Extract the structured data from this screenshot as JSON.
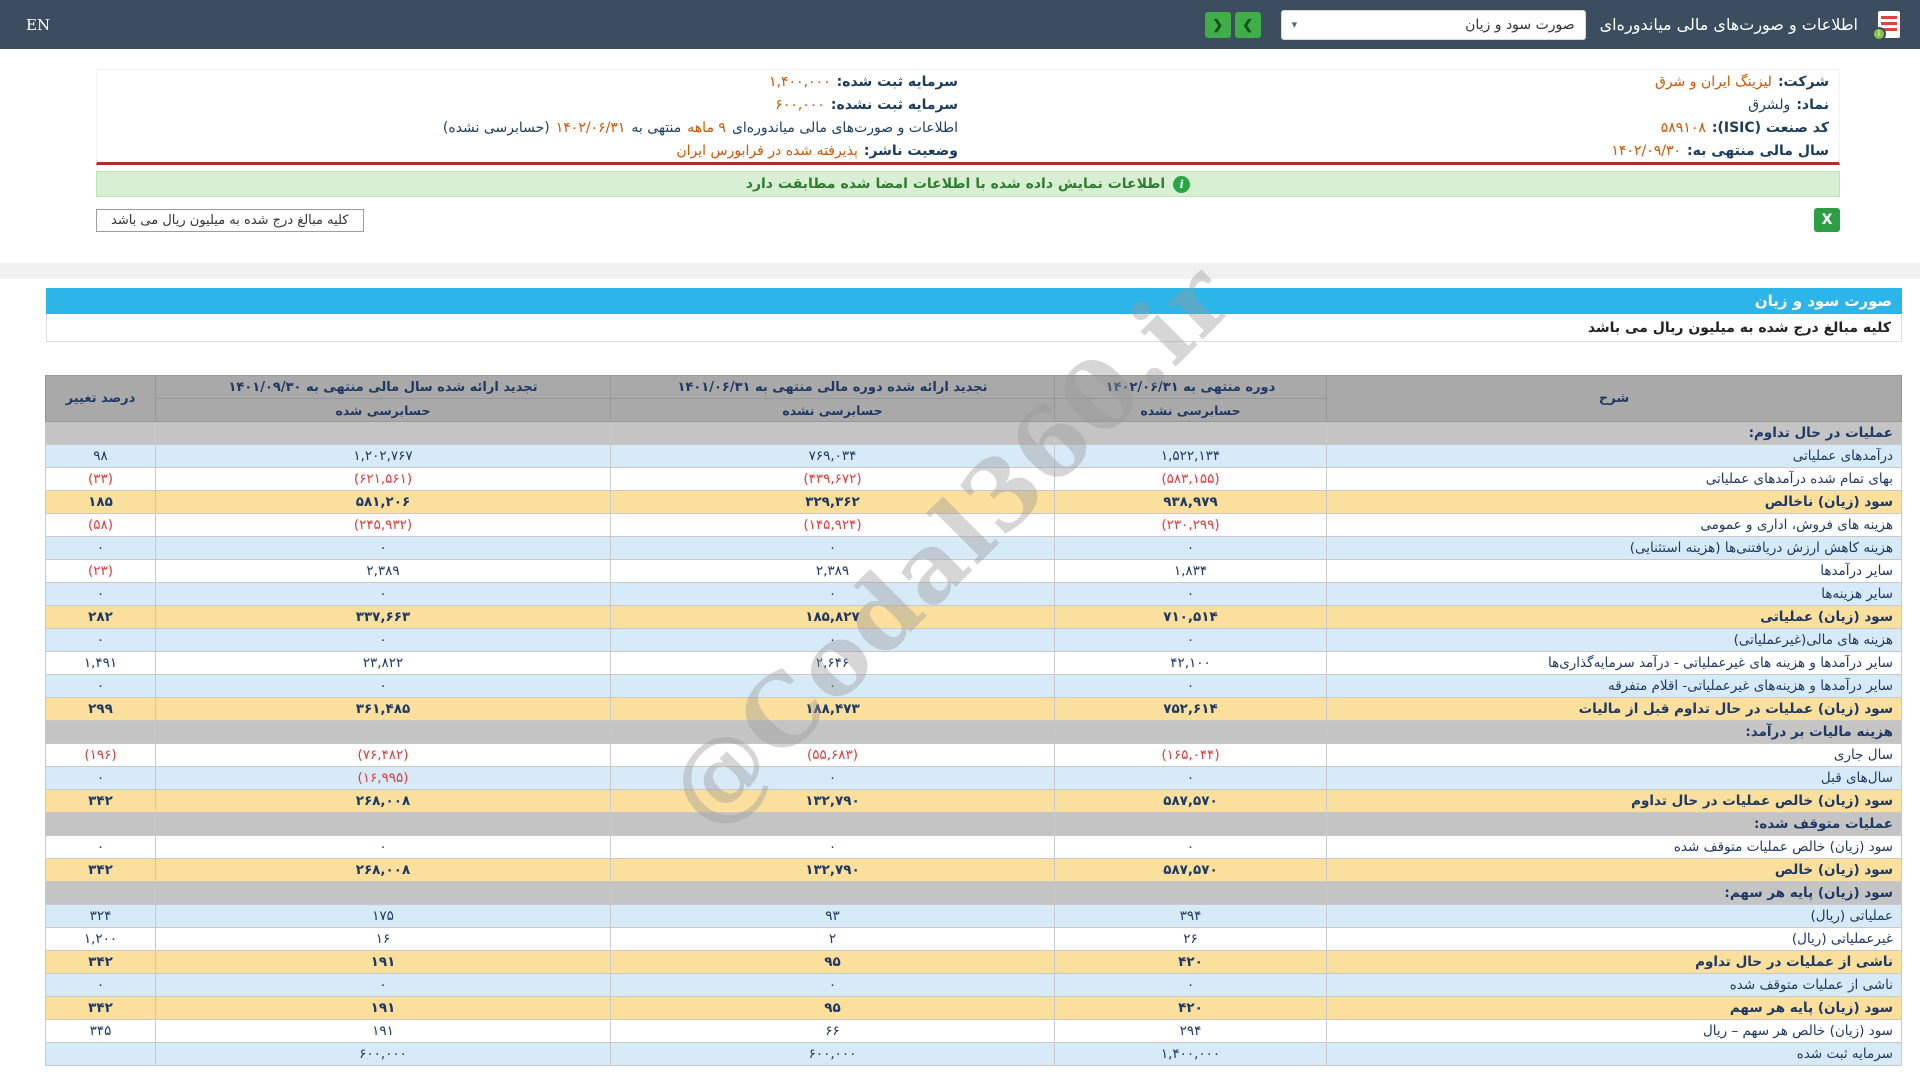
{
  "topbar": {
    "title": "اطلاعات و صورت‌های مالی میاندوره‌ای",
    "select_value": "صورت سود و زیان",
    "select_caret": "▾",
    "nav_forward": "❯",
    "nav_back": "❮",
    "lang": "EN"
  },
  "company_info": {
    "right": [
      {
        "label": "شرکت:",
        "value": "لیزینگ ایران و شرق"
      },
      {
        "label": "نماد:",
        "value": "ولشرق"
      },
      {
        "label": "کد صنعت (ISIC):",
        "value": "۵۸۹۱۰۸"
      },
      {
        "label": "سال مالی منتهی به:",
        "value": "۱۴۰۲/۰۹/۳۰"
      }
    ],
    "left": [
      {
        "label": "سرمایه ثبت شده:",
        "value": "۱,۴۰۰,۰۰۰"
      },
      {
        "label": "سرمایه ثبت نشده:",
        "value": "۶۰۰,۰۰۰"
      }
    ],
    "interim": {
      "prefix": "اطلاعات و صورت‌های مالی میاندوره‌ای",
      "period": "۹ ماهه",
      "mid": "منتهی به",
      "date": "۱۴۰۲/۰۶/۳۱",
      "suffix": "(حسابرسی نشده)"
    },
    "issuer": {
      "label": "وضعیت ناشر:",
      "value": "پذیرفته شده در فرابورس ایران"
    }
  },
  "signed_banner": {
    "text": "اطلاعات نمایش داده شده با اطلاعات امضا شده مطابقت دارد",
    "icon_glyph": "i"
  },
  "amounts_note": "کلیه مبالغ درج شده به میلیون ریال می باشد",
  "excel_icon_glyph": "X",
  "report": {
    "title": "صورت سود و زیان",
    "note": "کلیه مبالغ درج شده به میلیون ریال می باشد",
    "watermark": "@Codal360.ir"
  },
  "income_statement": {
    "columns": {
      "desc": "شرح",
      "current": {
        "title": "دوره منتهی به ۱۴۰۲/۰۶/۳۱",
        "audit": "حسابرسی نشده"
      },
      "restated_period": {
        "title": "تجدید ارائه شده دوره مالی منتهی به ۱۴۰۱/۰۶/۳۱",
        "audit": "حسابرسی نشده"
      },
      "restated_year": {
        "title": "تجدید ارائه شده سال مالی منتهی به ۱۴۰۱/۰۹/۳۰",
        "audit": "حسابرسی شده"
      },
      "change": "درصد تغییر"
    },
    "rows": [
      {
        "style": "section",
        "label": "عملیات در حال تداوم:",
        "values": [
          "",
          "",
          "",
          ""
        ]
      },
      {
        "style": "blue",
        "label": "درآمدهای عملیاتی",
        "values": [
          "۱,۵۲۲,۱۳۴",
          "۷۶۹,۰۳۴",
          "۱,۲۰۲,۷۶۷",
          "۹۸"
        ]
      },
      {
        "style": "white",
        "label": "بهای تمام شده درآمدهای عملیاتی",
        "values": [
          "(۵۸۳,۱۵۵)",
          "(۴۳۹,۶۷۲)",
          "(۶۲۱,۵۶۱)",
          "(۳۳)"
        ]
      },
      {
        "style": "yellow",
        "label": "سود (زیان) ناخالص",
        "values": [
          "۹۳۸,۹۷۹",
          "۳۲۹,۳۶۲",
          "۵۸۱,۲۰۶",
          "۱۸۵"
        ]
      },
      {
        "style": "white",
        "label": "هزینه های فروش، اداری و عمومی",
        "values": [
          "(۲۳۰,۲۹۹)",
          "(۱۴۵,۹۲۴)",
          "(۲۴۵,۹۳۲)",
          "(۵۸)"
        ]
      },
      {
        "style": "blue",
        "label": "هزینه کاهش ارزش دریافتنی‌ها (هزینه استثنایی)",
        "values": [
          "۰",
          "۰",
          "۰",
          "۰"
        ]
      },
      {
        "style": "white",
        "label": "سایر درآمدها",
        "values": [
          "۱,۸۳۴",
          "۲,۳۸۹",
          "۲,۳۸۹",
          "(۲۳)"
        ]
      },
      {
        "style": "blue",
        "label": "سایر هزینه‌ها",
        "values": [
          "۰",
          "۰",
          "۰",
          "۰"
        ]
      },
      {
        "style": "yellow",
        "label": "سود (زیان) عملیاتی",
        "values": [
          "۷۱۰,۵۱۴",
          "۱۸۵,۸۲۷",
          "۳۳۷,۶۶۳",
          "۲۸۲"
        ]
      },
      {
        "style": "blue",
        "label": "هزینه های مالی(غیرعملیاتی)",
        "values": [
          "۰",
          "۰",
          "۰",
          "۰"
        ]
      },
      {
        "style": "white",
        "label": "سایر درآمدها و هزینه های غیرعملیاتی - درآمد سرمایه‌گذاری‌ها",
        "values": [
          "۴۲,۱۰۰",
          "۲,۶۴۶",
          "۲۳,۸۲۲",
          "۱,۴۹۱"
        ]
      },
      {
        "style": "blue",
        "label": "سایر درآمدها و هزینه‌های غیرعملیاتی- اقلام متفرقه",
        "values": [
          "۰",
          "۰",
          "۰",
          "۰"
        ]
      },
      {
        "style": "yellow",
        "label": "سود (زیان) عملیات در حال تداوم قبل از مالیات",
        "values": [
          "۷۵۲,۶۱۴",
          "۱۸۸,۴۷۳",
          "۳۶۱,۴۸۵",
          "۲۹۹"
        ]
      },
      {
        "style": "section",
        "label": "هزینه مالیات بر درآمد:",
        "values": [
          "",
          "",
          "",
          ""
        ]
      },
      {
        "style": "white",
        "label": "سال جاری",
        "values": [
          "(۱۶۵,۰۴۴)",
          "(۵۵,۶۸۳)",
          "(۷۶,۴۸۲)",
          "(۱۹۶)"
        ]
      },
      {
        "style": "blue",
        "label": "سال‌های قبل",
        "values": [
          "۰",
          "۰",
          "(۱۶,۹۹۵)",
          "۰"
        ]
      },
      {
        "style": "yellow",
        "label": "سود (زیان) خالص عملیات در حال تداوم",
        "values": [
          "۵۸۷,۵۷۰",
          "۱۳۲,۷۹۰",
          "۲۶۸,۰۰۸",
          "۳۴۲"
        ]
      },
      {
        "style": "section",
        "label": "عملیات متوقف شده:",
        "values": [
          "",
          "",
          "",
          ""
        ]
      },
      {
        "style": "white",
        "label": "سود (زیان) خالص عملیات متوقف شده",
        "values": [
          "۰",
          "۰",
          "۰",
          "۰"
        ]
      },
      {
        "style": "yellow",
        "label": "سود (زیان) خالص",
        "values": [
          "۵۸۷,۵۷۰",
          "۱۳۲,۷۹۰",
          "۲۶۸,۰۰۸",
          "۳۴۲"
        ]
      },
      {
        "style": "section",
        "label": "سود (زیان) پایه هر سهم:",
        "values": [
          "",
          "",
          "",
          ""
        ]
      },
      {
        "style": "blue",
        "label": "عملیاتی (ریال)",
        "values": [
          "۳۹۴",
          "۹۳",
          "۱۷۵",
          "۳۲۴"
        ]
      },
      {
        "style": "white",
        "label": "غیرعملیاتی (ریال)",
        "values": [
          "۲۶",
          "۲",
          "۱۶",
          "۱,۲۰۰"
        ]
      },
      {
        "style": "yellow",
        "label": "ناشی از عملیات در حال تداوم",
        "values": [
          "۴۲۰",
          "۹۵",
          "۱۹۱",
          "۳۴۲"
        ]
      },
      {
        "style": "blue",
        "label": "ناشی از عملیات متوقف شده",
        "values": [
          "۰",
          "۰",
          "۰",
          "۰"
        ]
      },
      {
        "style": "yellow",
        "label": "سود (زیان) پایه هر سهم",
        "values": [
          "۴۲۰",
          "۹۵",
          "۱۹۱",
          "۳۴۲"
        ]
      },
      {
        "style": "white",
        "label": "سود (زیان) خالص هر سهم – ریال",
        "values": [
          "۲۹۴",
          "۶۶",
          "۱۹۱",
          "۳۴۵"
        ]
      },
      {
        "style": "blue",
        "label": "سرمایه ثبت شده",
        "values": [
          "۱,۴۰۰,۰۰۰",
          "۶۰۰,۰۰۰",
          "۶۰۰,۰۰۰",
          ""
        ]
      }
    ]
  },
  "colors": {
    "topbar": "#3b4d5e",
    "accent_cyan": "#2cb5e8",
    "nav_green": "#3fae49",
    "row_blue": "#d7eaf8",
    "row_yellow": "#fbdf9d",
    "section_gray": "#c4c4c4",
    "negative_red": "#e23b3b",
    "value_orange": "#d35400",
    "banner_green": "#d9efd4",
    "divider_red": "#b02a2a"
  }
}
